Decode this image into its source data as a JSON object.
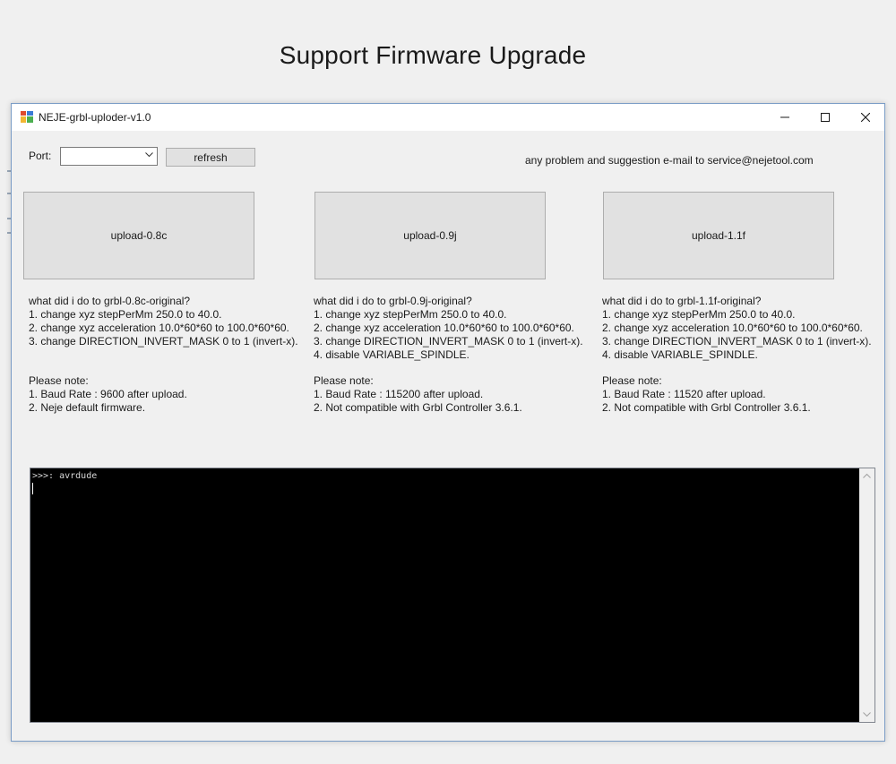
{
  "page": {
    "heading": "Support Firmware Upgrade"
  },
  "window": {
    "title": "NEJE-grbl-uploder-v1.0",
    "icon": "app-icon",
    "controls": {
      "minimize_icon": "minimize-icon",
      "maximize_icon": "maximize-icon",
      "close_icon": "close-icon"
    }
  },
  "toolbar": {
    "port_label": "Port:",
    "port_value": "",
    "refresh_label": "refresh",
    "contact_text": "any problem and suggestion e-mail to service@nejetool.com"
  },
  "uploads": [
    {
      "label": "upload-0.8c",
      "heading": "what did i do to grbl-0.8c-original?",
      "changes": [
        "1. change xyz stepPerMm 250.0 to 40.0.",
        "2. change xyz acceleration 10.0*60*60 to 100.0*60*60.",
        "3. change DIRECTION_INVERT_MASK 0 to 1 (invert-x)."
      ],
      "note_heading": "Please note:",
      "notes": [
        "1. Baud Rate : 9600 after upload.",
        "2. Neje default firmware."
      ]
    },
    {
      "label": "upload-0.9j",
      "heading": "what did i do to grbl-0.9j-original?",
      "changes": [
        "1. change xyz stepPerMm 250.0 to 40.0.",
        "2. change xyz acceleration 10.0*60*60 to 100.0*60*60.",
        "3. change DIRECTION_INVERT_MASK 0 to 1 (invert-x).",
        "4. disable VARIABLE_SPINDLE."
      ],
      "note_heading": "Please note:",
      "notes": [
        "1. Baud Rate : 115200 after upload.",
        "2. Not compatible with Grbl Controller 3.6.1."
      ]
    },
    {
      "label": "upload-1.1f",
      "heading": "what did i do to grbl-1.1f-original?",
      "changes": [
        "1. change xyz stepPerMm 250.0 to 40.0.",
        "2. change xyz acceleration 10.0*60*60 to 100.0*60*60.",
        "3. change DIRECTION_INVERT_MASK 0 to 1 (invert-x).",
        "4. disable VARIABLE_SPINDLE."
      ],
      "note_heading": "Please note:",
      "notes": [
        "1. Baud Rate : 11520 after upload.",
        "2. Not compatible with Grbl Controller 3.6.1."
      ]
    }
  ],
  "console": {
    "text": ">>>: avrdude"
  },
  "colors": {
    "accent": "#7a9cc6",
    "console_bg": "#000000",
    "button_bg": "#e1e1e1"
  }
}
